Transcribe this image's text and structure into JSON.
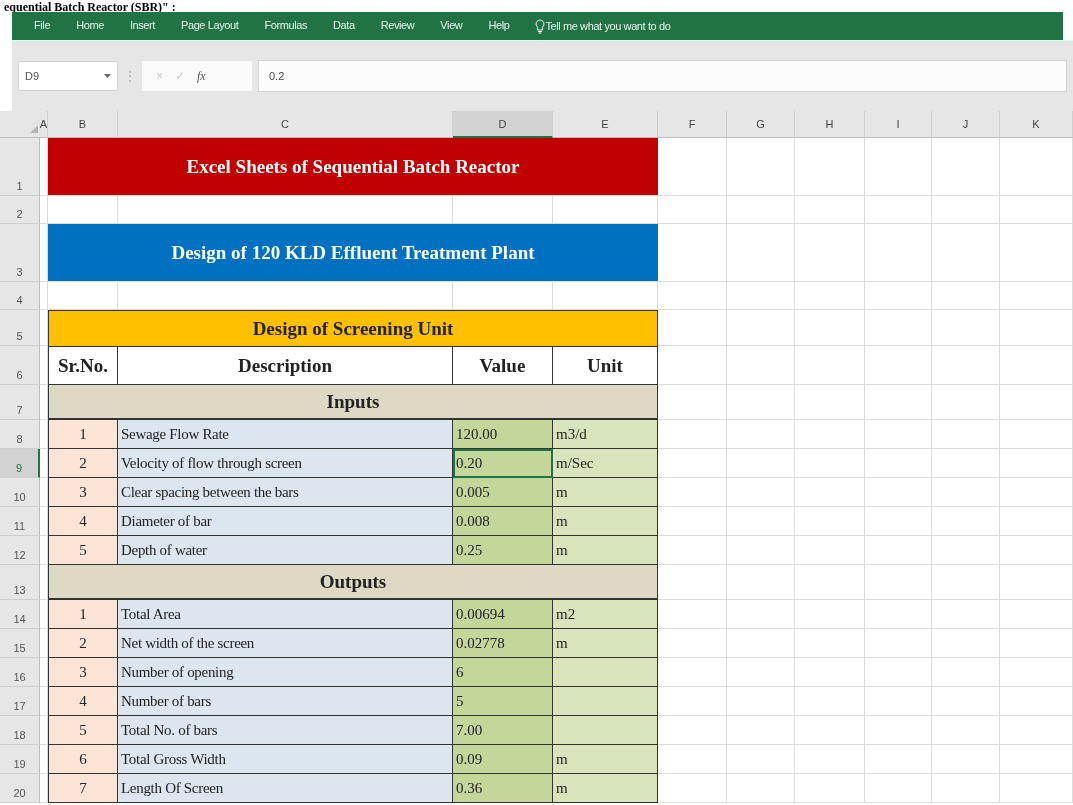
{
  "heading_fragment": "equential Batch Reactor (SBR)\" :",
  "ribbon": {
    "tabs": [
      {
        "label": "File",
        "selected": false
      },
      {
        "label": "Home",
        "selected": false
      },
      {
        "label": "Insert",
        "selected": false
      },
      {
        "label": "Page Layout",
        "selected": false
      },
      {
        "label": "Formulas",
        "selected": false
      },
      {
        "label": "Data",
        "selected": false
      },
      {
        "label": "Review",
        "selected": false
      },
      {
        "label": "View",
        "selected": false
      },
      {
        "label": "Help",
        "selected": false
      }
    ],
    "tell_me": "Tell me what you want to do"
  },
  "formula_bar": {
    "name_box": "D9",
    "separator": "⋮",
    "cancel": "×",
    "enter": "✓",
    "function_symbol": "fx",
    "value": "0.2"
  },
  "columns": [
    {
      "label": "A",
      "selected": false
    },
    {
      "label": "B",
      "selected": false
    },
    {
      "label": "C",
      "selected": false
    },
    {
      "label": "D",
      "selected": true
    },
    {
      "label": "E",
      "selected": false
    },
    {
      "label": "F",
      "selected": false
    },
    {
      "label": "G",
      "selected": false
    },
    {
      "label": "H",
      "selected": false
    },
    {
      "label": "I",
      "selected": false
    },
    {
      "label": "J",
      "selected": false
    },
    {
      "label": "K",
      "selected": false
    }
  ],
  "rows": [
    {
      "number": "1",
      "kind": "banner",
      "text": "Excel Sheets of Sequential Batch Reactor",
      "color": "#c00000",
      "selected": false
    },
    {
      "number": "2",
      "kind": "blank",
      "selected": false
    },
    {
      "number": "3",
      "kind": "banner",
      "text": "Design of 120 KLD Effluent Treatment Plant",
      "color": "#0070c0",
      "selected": false
    },
    {
      "number": "4",
      "kind": "blank",
      "selected": false
    },
    {
      "number": "5",
      "kind": "title",
      "text": "Design of Screening Unit",
      "selected": false
    },
    {
      "number": "6",
      "kind": "header",
      "cells": [
        "Sr.No.",
        "Description",
        "Value",
        "Unit"
      ],
      "selected": false
    },
    {
      "number": "7",
      "kind": "section",
      "text": "Inputs",
      "selected": false
    },
    {
      "number": "8",
      "kind": "item",
      "sr": "1",
      "description": "Sewage Flow Rate",
      "value": "120.00",
      "unit": "m3/d",
      "selected": false
    },
    {
      "number": "9",
      "kind": "item",
      "sr": "2",
      "description": "Velocity of flow through screen",
      "value": "0.20",
      "unit": "m/Sec",
      "selected": true
    },
    {
      "number": "10",
      "kind": "item",
      "sr": "3",
      "description": "Clear spacing between the bars",
      "value": "0.005",
      "unit": "m",
      "selected": false
    },
    {
      "number": "11",
      "kind": "item",
      "sr": "4",
      "description": "Diameter of bar",
      "value": "0.008",
      "unit": "m",
      "selected": false
    },
    {
      "number": "12",
      "kind": "item",
      "sr": "5",
      "description": "Depth of water",
      "value": "0.25",
      "unit": "m",
      "selected": false
    },
    {
      "number": "13",
      "kind": "section",
      "text": "Outputs",
      "selected": false
    },
    {
      "number": "14",
      "kind": "item",
      "sr": "1",
      "description": "Total Area",
      "value": "0.00694",
      "unit": "m2",
      "selected": false
    },
    {
      "number": "15",
      "kind": "item",
      "sr": "2",
      "description": "Net width of the screen",
      "value": "0.02778",
      "unit": "m",
      "selected": false
    },
    {
      "number": "16",
      "kind": "item",
      "sr": "3",
      "description": "Number of opening",
      "value": "6",
      "selected": false
    },
    {
      "number": "17",
      "kind": "item",
      "sr": "4",
      "description": "Number of bars",
      "value": "5",
      "selected": false
    },
    {
      "number": "18",
      "kind": "item",
      "sr": "5",
      "description": "Total No. of bars",
      "value": "7.00",
      "selected": false
    },
    {
      "number": "19",
      "kind": "item",
      "sr": "6",
      "description": "Total Gross Width",
      "value": "0.09",
      "unit": "m",
      "selected": false
    },
    {
      "number": "20",
      "kind": "item",
      "sr": "7",
      "description": "Length Of Screen",
      "value": "0.36",
      "unit": "m",
      "selected": false
    }
  ]
}
